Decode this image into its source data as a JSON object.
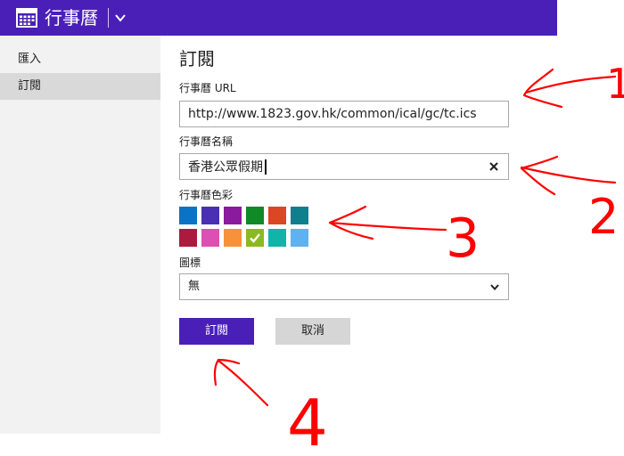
{
  "header": {
    "title": "行事曆",
    "bg_color": "#4a1fb8"
  },
  "sidebar": {
    "items": [
      {
        "label": "匯入",
        "selected": false
      },
      {
        "label": "訂閱",
        "selected": true
      }
    ]
  },
  "form": {
    "title": "訂閱",
    "url_label": "行事曆 URL",
    "url_value": "http://www.1823.gov.hk/common/ical/gc/tc.ics",
    "name_label": "行事曆名稱",
    "name_value": "香港公眾假期",
    "color_label": "行事曆色彩",
    "colors": [
      {
        "hex": "#0b73c6",
        "selected": false
      },
      {
        "hex": "#4a2fb3",
        "selected": false
      },
      {
        "hex": "#8a1a9e",
        "selected": false
      },
      {
        "hex": "#0f8a26",
        "selected": false
      },
      {
        "hex": "#d94822",
        "selected": false
      },
      {
        "hex": "#0f7f8e",
        "selected": false
      },
      {
        "hex": "#ac1a40",
        "selected": false
      },
      {
        "hex": "#dc4fb3",
        "selected": false
      },
      {
        "hex": "#f5923b",
        "selected": false
      },
      {
        "hex": "#8cb821",
        "selected": true
      },
      {
        "hex": "#12b3a8",
        "selected": false
      },
      {
        "hex": "#5fb2ef",
        "selected": false
      }
    ],
    "icon_label": "圖標",
    "icon_value": "無",
    "subscribe_button": "訂閱",
    "cancel_button": "取消"
  },
  "annotations": {
    "numbers": [
      "1",
      "2",
      "3",
      "4"
    ],
    "color": "#ff0000"
  }
}
